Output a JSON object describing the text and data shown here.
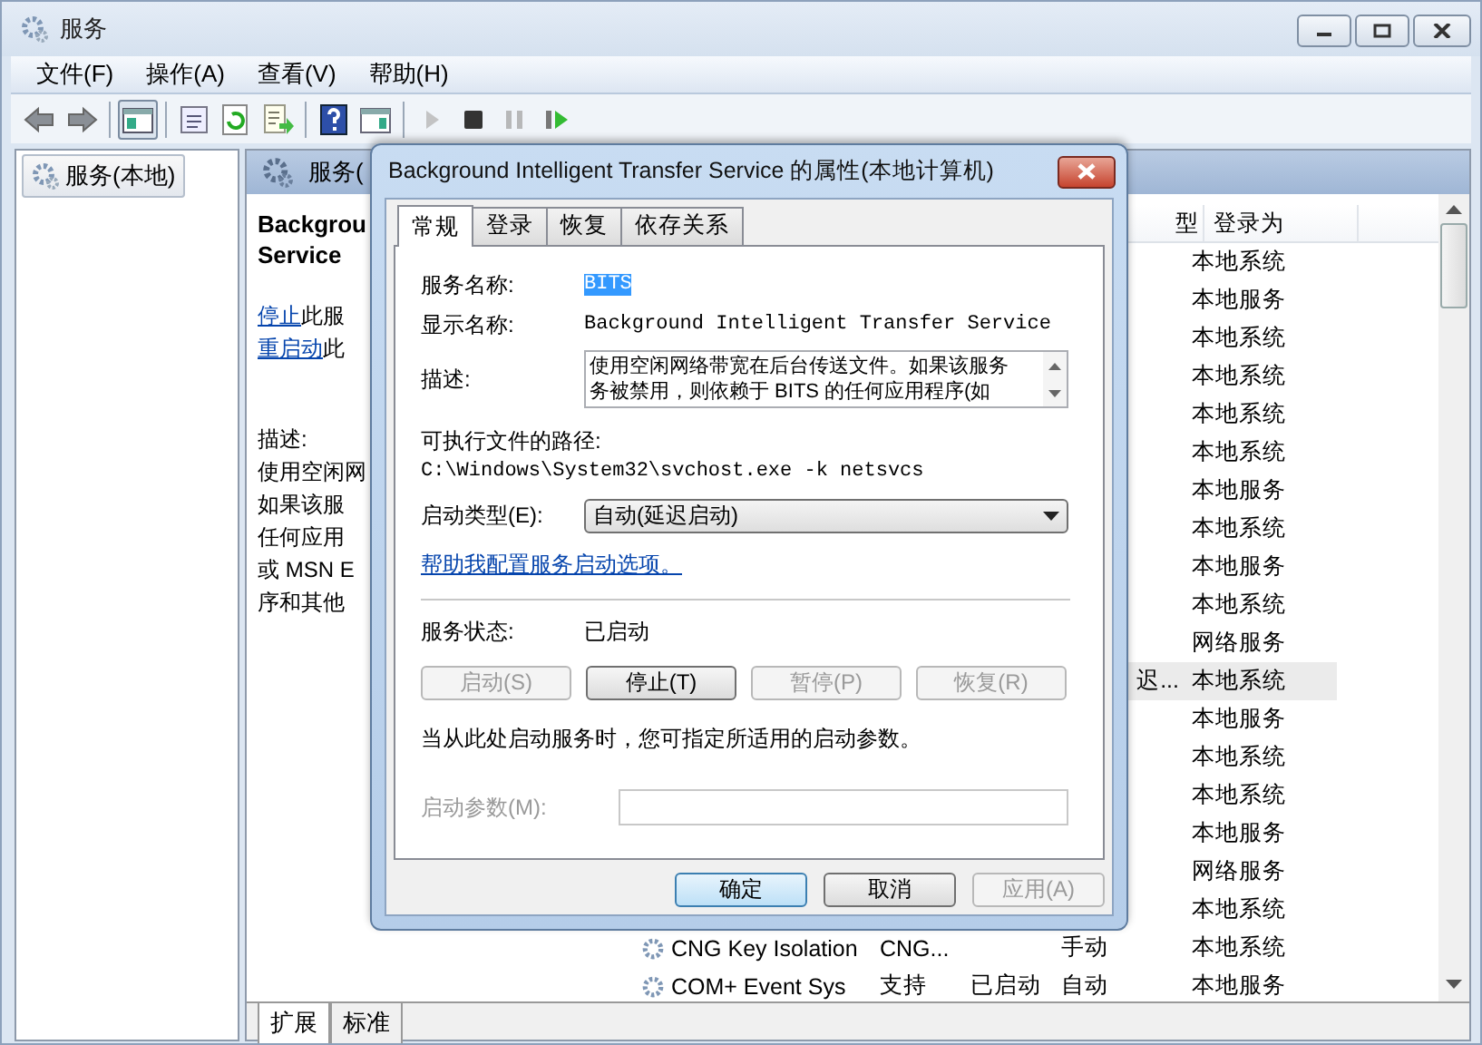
{
  "window": {
    "title": "服务"
  },
  "menu": [
    {
      "label": "文件(F)"
    },
    {
      "label": "操作(A)"
    },
    {
      "label": "查看(V)"
    },
    {
      "label": "帮助(H)"
    }
  ],
  "toolbar_groups": [
    [
      {
        "kind": "back",
        "pressed": false,
        "disabled": false
      },
      {
        "kind": "forward",
        "pressed": false,
        "disabled": false
      }
    ],
    [
      {
        "kind": "tree",
        "pressed": true,
        "disabled": false
      }
    ],
    [
      {
        "kind": "properties",
        "pressed": false,
        "disabled": false
      },
      {
        "kind": "refresh",
        "pressed": false,
        "disabled": false
      },
      {
        "kind": "export",
        "pressed": false,
        "disabled": false
      }
    ],
    [
      {
        "kind": "help",
        "pressed": false,
        "disabled": false
      },
      {
        "kind": "pane",
        "pressed": false,
        "disabled": false
      }
    ],
    [
      {
        "kind": "start",
        "pressed": false,
        "disabled": true
      },
      {
        "kind": "stop",
        "pressed": false,
        "disabled": false
      },
      {
        "kind": "pause",
        "pressed": false,
        "disabled": true
      },
      {
        "kind": "restart",
        "pressed": false,
        "disabled": false
      }
    ]
  ],
  "tree": [
    {
      "label": "服务(本地)",
      "selected": true
    }
  ],
  "pane_title": "服务(",
  "extended": {
    "title_lines": [
      "Backgrou",
      "Service"
    ],
    "actions": [
      {
        "link": "停止",
        "text": "此服"
      },
      {
        "link": "重启动",
        "text": "此"
      }
    ],
    "desc_label": "描述:",
    "desc_lines": [
      "使用空闲网",
      "如果该服",
      "任何应用",
      "或 MSN E",
      "序和其他"
    ]
  },
  "columns": [
    {
      "label": "型"
    },
    {
      "label": "登录为"
    }
  ],
  "rows": [
    {
      "logon": "本地系统",
      "selected": false
    },
    {
      "logon": "本地服务",
      "selected": false
    },
    {
      "logon": "本地系统",
      "selected": false
    },
    {
      "logon": "本地系统",
      "selected": false
    },
    {
      "logon": "本地系统",
      "selected": false
    },
    {
      "logon": "本地系统",
      "selected": false
    },
    {
      "logon": "本地服务",
      "selected": false
    },
    {
      "logon": "本地系统",
      "selected": false
    },
    {
      "logon": "本地服务",
      "selected": false
    },
    {
      "logon": "本地系统",
      "selected": false
    },
    {
      "logon": "网络服务",
      "selected": false
    },
    {
      "startup": "迟...",
      "logon": "本地系统",
      "selected": true
    },
    {
      "logon": "本地服务",
      "selected": false
    },
    {
      "logon": "本地系统",
      "selected": false
    },
    {
      "logon": "本地系统",
      "selected": false
    },
    {
      "logon": "本地服务",
      "selected": false
    },
    {
      "logon": "网络服务",
      "selected": false
    },
    {
      "logon": "本地系统",
      "selected": false
    },
    {
      "name": "CNG Key Isolation",
      "description": "CNG...",
      "startup": "手动",
      "logon": "本地系统",
      "selected": false
    },
    {
      "name": "COM+ Event Sys",
      "description": "支持",
      "status": "已启动",
      "startup": "自动",
      "logon": "本地服务",
      "selected": false
    }
  ],
  "bottom_tabs": [
    {
      "label": "扩展",
      "selected": true
    },
    {
      "label": "标准",
      "selected": false
    }
  ],
  "dialog": {
    "title": "Background Intelligent Transfer Service 的属性(本地计算机)",
    "tabs": [
      {
        "label": "常规",
        "selected": true
      },
      {
        "label": "登录",
        "selected": false
      },
      {
        "label": "恢复",
        "selected": false
      },
      {
        "label": "依存关系",
        "selected": false
      }
    ],
    "fields": [
      {
        "label": "服务名称:",
        "value": "BITS",
        "highlighted": true
      },
      {
        "label": "显示名称:",
        "value": "Background Intelligent Transfer Service",
        "highlighted": false
      }
    ],
    "description": {
      "label": "描述:",
      "lines": [
        "使用空闲网络带宽在后台传送文件。如果该服务",
        "务被禁用，则依赖于 BITS 的任何应用程序(如"
      ]
    },
    "path_label": "可执行文件的路径:",
    "path": "C:\\Windows\\System32\\svchost.exe -k netsvcs",
    "startup_type": {
      "label": "启动类型(E):",
      "value": "自动(延迟启动)"
    },
    "help_link": "帮助我配置服务启动选项。",
    "status": {
      "label": "服务状态:",
      "value": "已启动"
    },
    "service_buttons": [
      {
        "label": "启动(S)",
        "disabled": true
      },
      {
        "label": "停止(T)",
        "disabled": false
      },
      {
        "label": "暂停(P)",
        "disabled": true
      },
      {
        "label": "恢复(R)",
        "disabled": true
      }
    ],
    "note": "当从此处启动服务时，您可指定所适用的启动参数。",
    "params": {
      "label": "启动参数(M):",
      "disabled": true
    },
    "buttons": [
      {
        "label": "确定",
        "default": true,
        "disabled": false
      },
      {
        "label": "取消",
        "default": false,
        "disabled": false
      },
      {
        "label": "应用(A)",
        "default": false,
        "disabled": true
      }
    ]
  }
}
